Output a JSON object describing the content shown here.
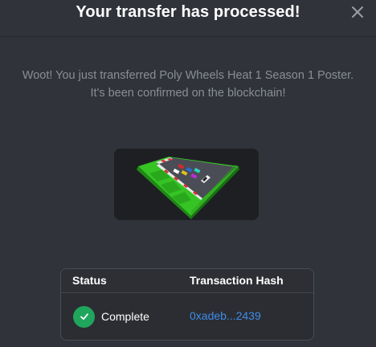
{
  "modal": {
    "title": "Your transfer has processed!",
    "close_icon": "close-icon",
    "message_line1": "Woot! You just transferred Poly Wheels Heat 1 Season 1 Poster.",
    "message_line2": "It's been confirmed on the blockchain!"
  },
  "poster": {
    "icon": "race-track-image"
  },
  "table": {
    "headers": {
      "status": "Status",
      "hash": "Transaction Hash"
    },
    "row": {
      "status_icon": "check-circle-icon",
      "status": "Complete",
      "hash": "0xadeb...2439"
    }
  },
  "colors": {
    "background": "#303339",
    "success": "#1fa55c",
    "link": "#3e8ce8",
    "muted_text": "#8a8e95"
  }
}
